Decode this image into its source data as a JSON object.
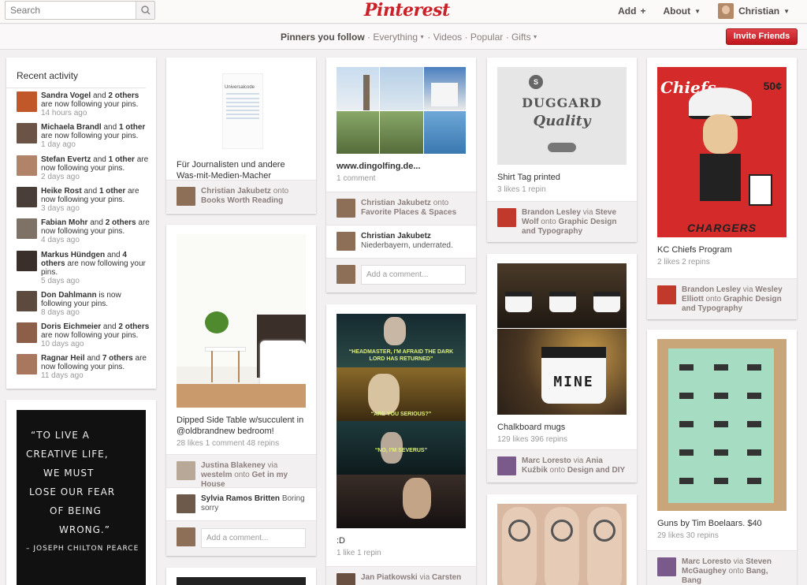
{
  "header": {
    "search_placeholder": "Search",
    "logo": "Pinterest",
    "add_label": "Add",
    "add_icon": "+",
    "about_label": "About",
    "user_name": "Christian"
  },
  "subnav": {
    "following": "Pinners you follow",
    "everything": "Everything",
    "videos": "Videos",
    "popular": "Popular",
    "gifts": "Gifts",
    "sep": "·",
    "invite": "Invite Friends"
  },
  "activity": {
    "title": "Recent activity",
    "rows": [
      {
        "name": "Sandra Vogel",
        "mid": " and ",
        "others": "2 others",
        "rest": " are now following your pins.",
        "ago": "14 hours ago"
      },
      {
        "name": "Michaela Brandl",
        "mid": " and ",
        "others": "1 other",
        "rest": " are now following your pins.",
        "ago": "1 day ago"
      },
      {
        "name": "Stefan Evertz",
        "mid": " and ",
        "others": "1 other",
        "rest": " are now following your pins.",
        "ago": "2 days ago"
      },
      {
        "name": "Heike Rost",
        "mid": " and ",
        "others": "1 other",
        "rest": " are now following your pins.",
        "ago": "3 days ago"
      },
      {
        "name": "Fabian Mohr",
        "mid": " and ",
        "others": "2 others",
        "rest": " are now following your pins.",
        "ago": "4 days ago"
      },
      {
        "name": "Markus Hündgen",
        "mid": " and ",
        "others": "4 others",
        "rest": " are now following your pins.",
        "ago": "5 days ago"
      },
      {
        "name": "Don Dahlmann",
        "mid": "",
        "others": "",
        "rest": " is now following your pins.",
        "ago": "8 days ago"
      },
      {
        "name": "Doris Eichmeier",
        "mid": " and ",
        "others": "2 others",
        "rest": " are now following your pins.",
        "ago": "10 days ago"
      },
      {
        "name": "Ragnar Heil",
        "mid": " and ",
        "others": "7 others",
        "rest": " are now following your pins.",
        "ago": "11 days ago"
      }
    ]
  },
  "quote": {
    "l1": "“TO LIVE A",
    "l2": "CREATIVE LIFE,",
    "l3": "WE MUST",
    "l4": "LOSE OUR FEAR",
    "l5": "OF BEING",
    "l6": "WRONG.”",
    "l7": "– JOSEPH CHILTON PEARCE"
  },
  "pins": {
    "p1": {
      "img_title": "Universalcode",
      "desc": "Für Journalisten und andere Was-mit-Medien-Macher",
      "user": "Christian Jakubetz",
      "onto": " onto ",
      "board": "Books Worth Reading"
    },
    "p2": {
      "desc": "Dipped Side Table w/succulent in @oldbrandnew bedroom!",
      "stats": "28 likes  1 comment  48 repins",
      "src_user": "Justina Blakeney",
      "via": " via ",
      "via_user": "westelm",
      "onto": " onto ",
      "board": "Get in my House",
      "c_user": "Sylvia Ramos Britten",
      "c_text": " Boring sorry",
      "add_comment": "Add a comment..."
    },
    "p3": {
      "desc": "www.dingolfing.de...",
      "stats": "1 comment",
      "user": "Christian Jakubetz",
      "onto": " onto ",
      "board": "Favorite Places & Spaces",
      "c_user": "Christian Jakubetz",
      "c_text": "Niederbayern, underrated.",
      "add_comment": "Add a comment..."
    },
    "p4": {
      "cap1": "“HEADMASTER, I'M AFRAID THE DARK LORD HAS RETURNED”",
      "cap2": "“ARE YOU SERIOUS?”",
      "cap3": "“NO, I'M SEVERUS”",
      "desc": ":D",
      "stats": "1 like  1 repin",
      "user": "Jan Piatkowski",
      "via": " via ",
      "via_user": "Carsten"
    },
    "p5": {
      "desc": "Shirt Tag printed",
      "stats": "3 likes  1 repin",
      "user": "Brandon Lesley",
      "via": " via ",
      "via_user": "Steve Wolf",
      "onto": " onto ",
      "board": "Graphic Design and Typography",
      "tag_l1": "DUGGARD",
      "tag_l2": "Quality"
    },
    "p6": {
      "mug_text": "MINE",
      "desc": "Chalkboard mugs",
      "stats": "129 likes  396 repins",
      "user": "Marc Loresto",
      "via": " via ",
      "via_user": "Ania Kuźbik",
      "onto": " onto ",
      "board": "Design and DIY"
    },
    "p7": {
      "cover_brand": "Chiefs",
      "cover_price": "50¢",
      "cover_name": "CHARGERS",
      "desc": "KC Chiefs Program",
      "stats": "2 likes  2 repins",
      "user": "Brandon Lesley",
      "via": " via ",
      "via_user": "Wesley Elliott",
      "onto": " onto ",
      "board": "Graphic Design and Typography"
    },
    "p8": {
      "desc": "Guns by Tim Boelaars. $40",
      "stats": "29 likes  30 repins",
      "user": "Marc Loresto",
      "via": " via ",
      "via_user": "Steven McGaughey",
      "onto": " onto ",
      "board": "Bang, Bang"
    }
  }
}
